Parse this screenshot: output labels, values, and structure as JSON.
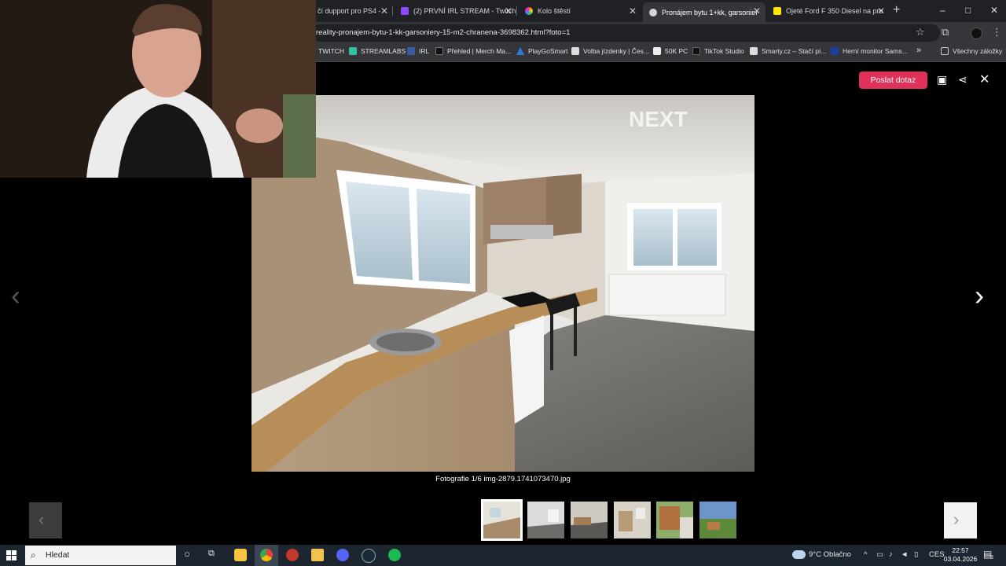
{
  "browser": {
    "tabs": [
      {
        "title": "čí dupport pro PS4 -",
        "active": false
      },
      {
        "title": "(2) PRVNÍ IRL STREAM - Twitch",
        "active": false
      },
      {
        "title": "Kolo štěstí",
        "active": false
      },
      {
        "title": "Pronájem bytu 1+kk, garsonier",
        "active": true
      },
      {
        "title": "Ojeté Ford F 350 Diesel na pro",
        "active": false
      }
    ],
    "new_tab": "+",
    "window_controls": {
      "minimize": "–",
      "maximize": "□",
      "close": "✕"
    },
    "url": "reality-pronajem-bytu-1-kk-garsoniery-15-m2-chranena-3698362.html?foto=1",
    "bookmarks": [
      {
        "label": "TWITCH",
        "color": "#9146ff"
      },
      {
        "label": "STREAMLABS",
        "color": "#31c3a2"
      },
      {
        "label": "IRL",
        "color": "#3a5ba0"
      },
      {
        "label": "Přehled | Merch Ma...",
        "color": "#111111"
      },
      {
        "label": "PlayGoSmart",
        "color": "#2d7be0"
      },
      {
        "label": "Volba jízdenky | Čes...",
        "color": "#dddddd"
      },
      {
        "label": "50K PC",
        "color": "#eeeeee"
      },
      {
        "label": "TikTok Studio",
        "color": "#111111"
      },
      {
        "label": "Smarty.cz – Stačí pí...",
        "color": "#dddddd"
      },
      {
        "label": "Herní monitor Sams...",
        "color": "#1d3f9b"
      }
    ],
    "bookmarks_more": "»",
    "all_bookmarks": "Všechny záložky"
  },
  "gallery": {
    "send_inquiry": "Poslat dotaz",
    "caption": "Fotografie 1/6 img-2879.1741073470.jpg",
    "watermark": "NEXT",
    "prev": "‹",
    "next": "›",
    "thumb_prev": "‹",
    "thumb_next": "›",
    "thumbnails": [
      {
        "name": "thumb-1",
        "selected": true
      },
      {
        "name": "thumb-2",
        "selected": false
      },
      {
        "name": "thumb-3",
        "selected": false
      },
      {
        "name": "thumb-4",
        "selected": false
      },
      {
        "name": "thumb-5",
        "selected": false
      },
      {
        "name": "thumb-6",
        "selected": false
      }
    ]
  },
  "taskbar": {
    "search_placeholder": "Hledat",
    "weather": "9°C  Oblačno",
    "language": "CES",
    "time": "22:57",
    "date": "03.04.2026",
    "notifications": "9"
  },
  "colors": {
    "accent": "#e0315a",
    "tabbar": "#202124",
    "toolbar": "#35363a",
    "taskbar": "#1c2530"
  }
}
